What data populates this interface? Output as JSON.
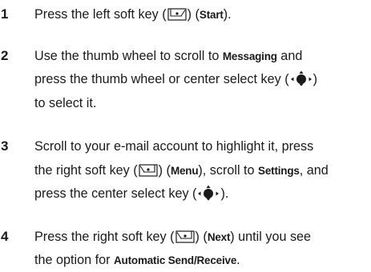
{
  "steps": [
    {
      "number": "1",
      "lines": [
        {
          "segments": [
            {
              "t": "Press the left soft key ("
            },
            {
              "icon": "left-soft-key-icon"
            },
            {
              "t": ") ("
            },
            {
              "b": "Start"
            },
            {
              "t": ")."
            }
          ]
        }
      ]
    },
    {
      "number": "2",
      "lines": [
        {
          "segments": [
            {
              "t": "Use the thumb wheel to scroll to "
            },
            {
              "b": "Messaging"
            },
            {
              "t": " and"
            }
          ]
        },
        {
          "segments": [
            {
              "t": "press the thumb wheel or center select key ("
            },
            {
              "icon": "center-select-key-icon"
            },
            {
              "t": ")"
            }
          ]
        },
        {
          "segments": [
            {
              "t": "to select it."
            }
          ]
        }
      ]
    },
    {
      "number": "3",
      "lines": [
        {
          "segments": [
            {
              "t": "Scroll to your e-mail account to highlight it, press"
            }
          ]
        },
        {
          "segments": [
            {
              "t": "the right soft key ("
            },
            {
              "icon": "right-soft-key-icon"
            },
            {
              "t": ") ("
            },
            {
              "b": "Menu"
            },
            {
              "t": "), scroll to "
            },
            {
              "b": "Settings"
            },
            {
              "t": ", and"
            }
          ]
        },
        {
          "segments": [
            {
              "t": "press the center select key ("
            },
            {
              "icon": "center-select-key-icon"
            },
            {
              "t": ")."
            }
          ]
        }
      ]
    },
    {
      "number": "4",
      "lines": [
        {
          "segments": [
            {
              "t": "Press the right soft key ("
            },
            {
              "icon": "right-soft-key-icon"
            },
            {
              "t": ") ("
            },
            {
              "b": "Next"
            },
            {
              "t": ") until you see"
            }
          ]
        },
        {
          "segments": [
            {
              "t": "the option for "
            },
            {
              "b": "Automatic Send/Receive"
            },
            {
              "t": "."
            }
          ]
        }
      ]
    }
  ]
}
